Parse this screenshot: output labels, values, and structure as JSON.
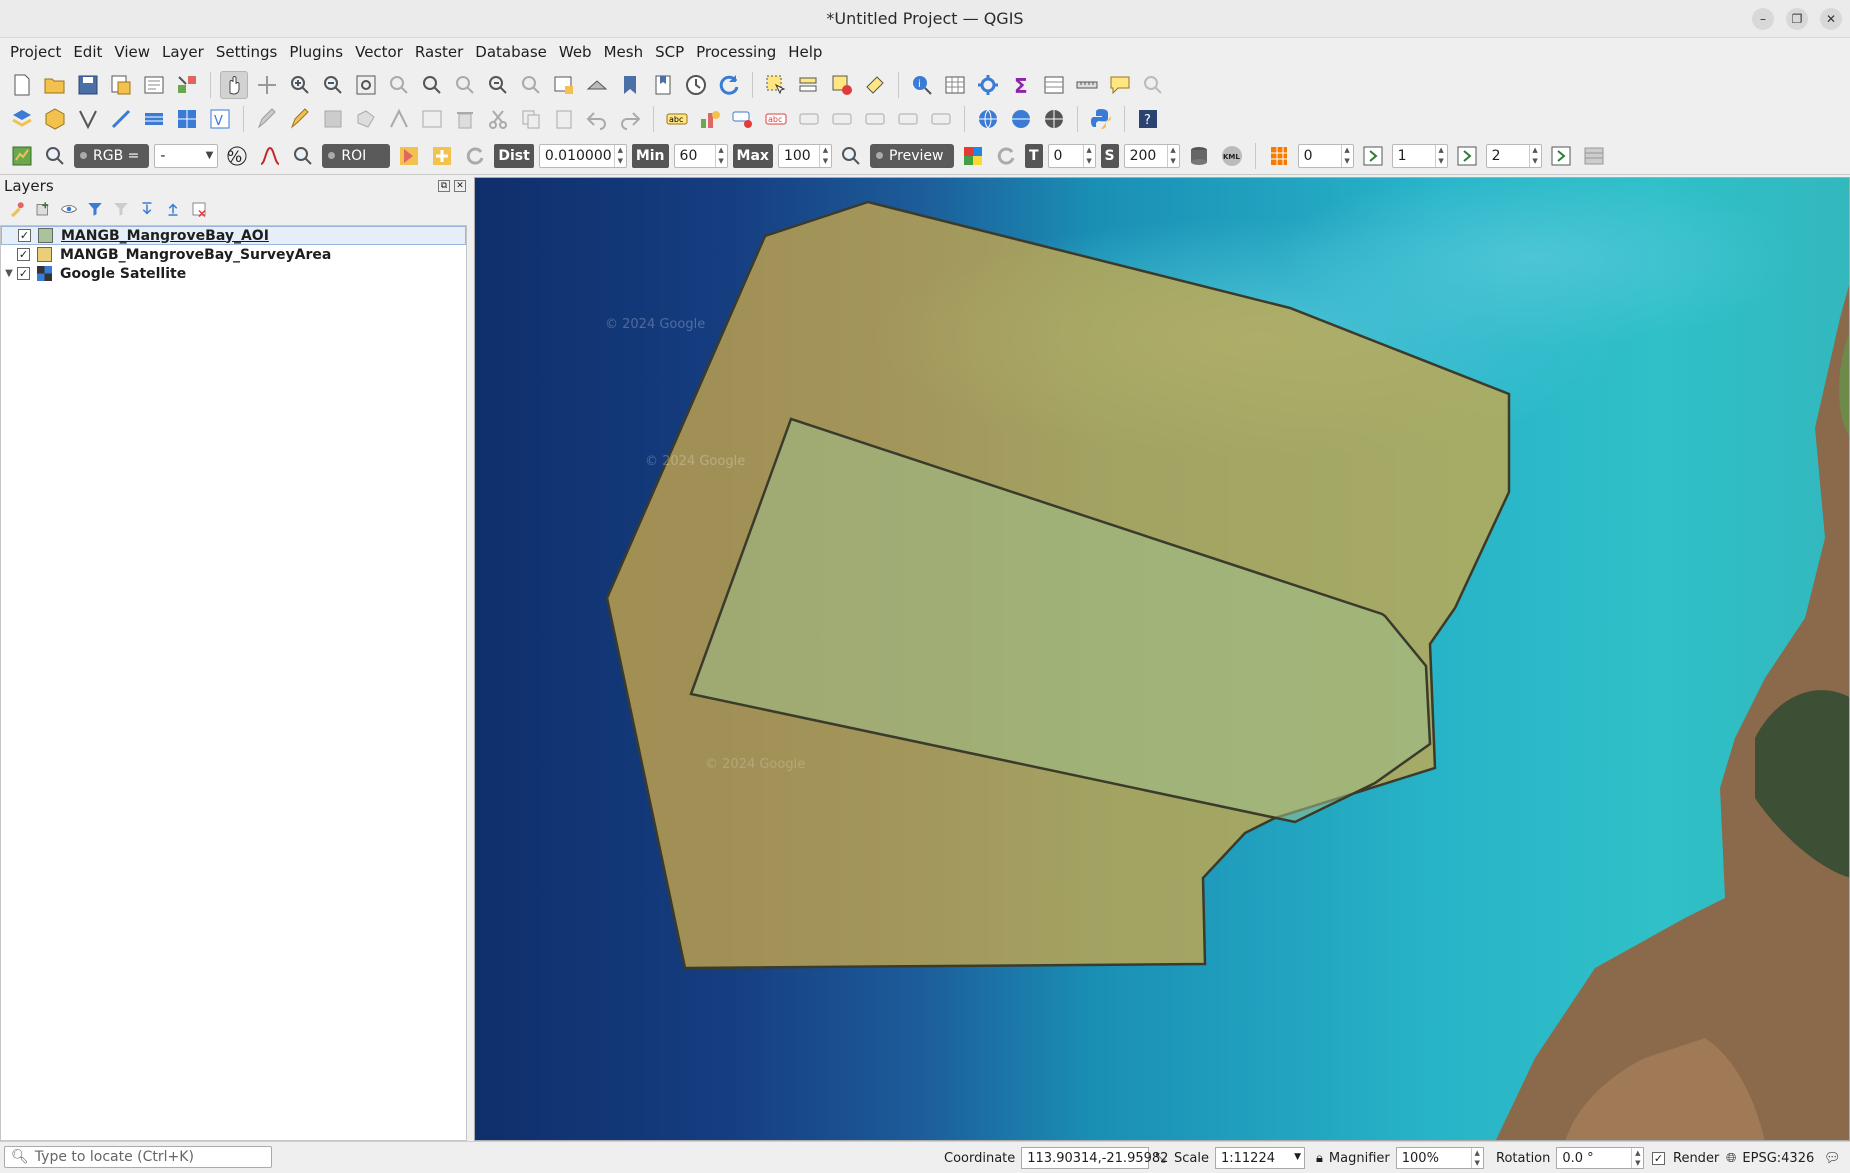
{
  "window": {
    "title": "*Untitled Project — QGIS"
  },
  "menu": [
    "Project",
    "Edit",
    "View",
    "Layer",
    "Settings",
    "Plugins",
    "Vector",
    "Raster",
    "Database",
    "Web",
    "Mesh",
    "SCP",
    "Processing",
    "Help"
  ],
  "scp_toolbar": {
    "rgb_label": "RGB =",
    "rgb_value": "-",
    "roi_label": "ROI",
    "dist_label": "Dist",
    "dist_value": "0.010000",
    "min_label": "Min",
    "min_value": "60",
    "max_label": "Max",
    "max_value": "100",
    "preview_label": "Preview",
    "t_label": "T",
    "t_value": "0",
    "s_label": "S",
    "s_value": "200",
    "kml_label": "KML",
    "band_values": [
      "0",
      "1",
      "2"
    ]
  },
  "layers_panel": {
    "title": "Layers",
    "layers": [
      {
        "name": "MANGB_MangroveBay_AOI",
        "checked": true,
        "selected": true,
        "type": "polygon",
        "color": "#a9c49a"
      },
      {
        "name": "MANGB_MangroveBay_SurveyArea",
        "checked": true,
        "selected": false,
        "type": "polygon",
        "color": "#e9cf7a"
      },
      {
        "name": "Google Satellite",
        "checked": true,
        "selected": false,
        "type": "raster",
        "color": ""
      }
    ]
  },
  "map": {
    "watermarks": [
      "© 2024 Google",
      "© 2024 Google",
      "© 2024 Google"
    ],
    "survey_fill": "#c9a84a",
    "aoi_fill": "#9fbf8a"
  },
  "status": {
    "locator_placeholder": "Type to locate (Ctrl+K)",
    "coordinate_label": "Coordinate",
    "coordinate_value": "113.90314,-21.95982",
    "scale_label": "Scale",
    "scale_value": "1:11224",
    "magnifier_label": "Magnifier",
    "magnifier_value": "100%",
    "rotation_label": "Rotation",
    "rotation_value": "0.0 °",
    "render_label": "Render",
    "crs": "EPSG:4326"
  }
}
